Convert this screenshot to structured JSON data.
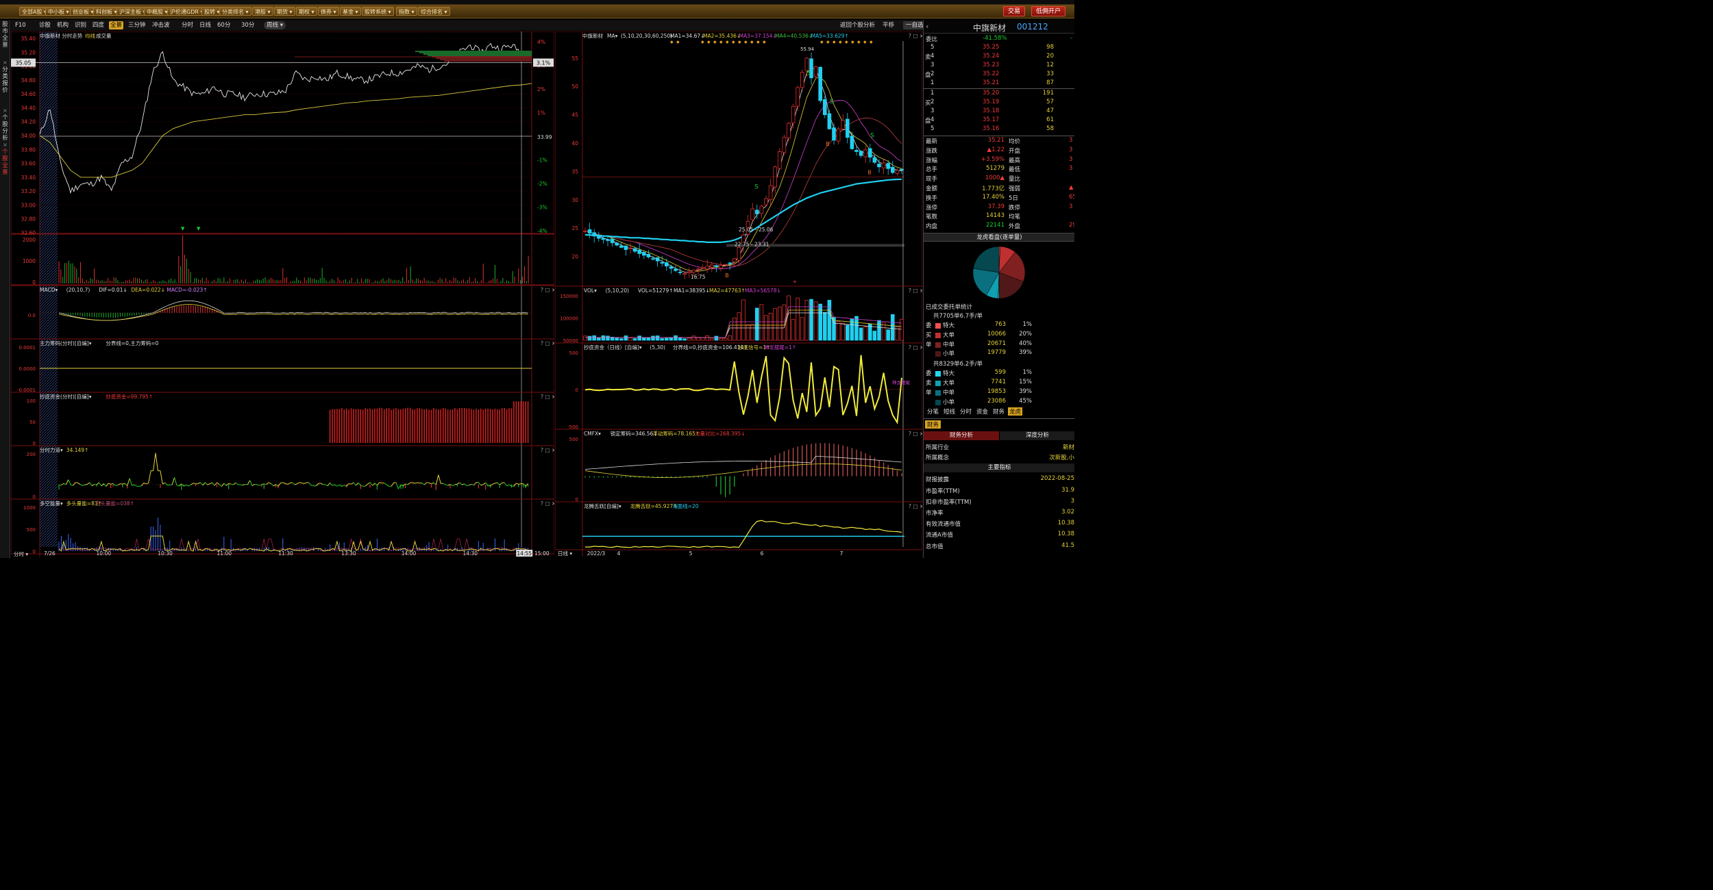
{
  "menu": {
    "items": [
      "全部A股",
      "中小板",
      "创业板",
      "科创板",
      "沪深主板",
      "中概股",
      "沪伦通GDR",
      "股转",
      "分类排名",
      "港股",
      "期货",
      "期权",
      "债券",
      "基金",
      "股转系统",
      "指数",
      "综合排名"
    ],
    "trade": "交易",
    "open_account": "低佣开户"
  },
  "toolbar": {
    "left": [
      "F10",
      "诊股",
      "机构",
      "识别",
      "四度",
      "全景",
      "三分钟",
      "冲击波"
    ],
    "selected": "全景",
    "periods": [
      "分时",
      "日线",
      "60分",
      "30分",
      "周线"
    ],
    "right": [
      "返回个股分析",
      "平移",
      "一自选"
    ]
  },
  "sidebar": [
    "股市全景",
    "分类报价",
    "个股分析",
    "个股全景"
  ],
  "stock": {
    "name": "中旗新材",
    "code": "001212"
  },
  "intraday": {
    "header": "中旗新材  分时走势",
    "avg_label": "均线",
    "vol_label": "成交量",
    "price_ticks": [
      "35.40",
      "35.20",
      "35.00",
      "34.80",
      "34.60",
      "34.40",
      "34.20",
      "34.00",
      "33.80",
      "33.60",
      "33.40",
      "33.20",
      "33.00",
      "32.80",
      "32.60"
    ],
    "pct_ticks": [
      "4%",
      "3%",
      "2%",
      "1%",
      "-1%",
      "-2%",
      "-3%",
      "-4%"
    ],
    "cursor_price": "35.05",
    "cursor_pct": "3.1%",
    "prev_close": "33.99",
    "vol_ticks": [
      "2000",
      "1000",
      "0"
    ],
    "time_ticks": [
      "分时",
      "7/26",
      "10:00",
      "10:30",
      "11:00",
      "11:30",
      "13:30",
      "14:00",
      "14:30",
      "14:55",
      "15:00"
    ],
    "sub_panels": [
      {
        "title": "MACD",
        "params": "(20,10,7)",
        "values": [
          {
            "t": "DIF=0.01↓",
            "c": "#e0e0e0"
          },
          {
            "t": "DEA=0.022↓",
            "c": "#e6d23a"
          },
          {
            "t": "MACD=-0.023↑",
            "c": "#d080ff"
          }
        ],
        "ticks": [
          "0.0"
        ]
      },
      {
        "title": "主力筹码(分时)[自编]",
        "params": "",
        "values": [
          {
            "t": "分界线=0,主力筹码=0",
            "c": "#e0e0e0"
          }
        ],
        "ticks": [
          "0.0001",
          "0.0000",
          "-0.0001"
        ]
      },
      {
        "title": "抄底资金(分时)[自编]",
        "params": "",
        "values": [
          {
            "t": "抄底资金=99.795↑",
            "c": "#f23a3a"
          }
        ],
        "ticks": [
          "100",
          "50",
          "0"
        ]
      },
      {
        "title": "分时力道",
        "params": "",
        "values": [
          {
            "t": "34.149↑",
            "c": "#e6d23a"
          }
        ],
        "ticks": [
          "200",
          "0"
        ]
      },
      {
        "title": "多空能量",
        "params": "",
        "values": [
          {
            "t": "多头量能=83↑",
            "c": "#e6d23a"
          },
          {
            "t": "空头量能=038↑",
            "c": "#c05070"
          }
        ],
        "ticks": [
          "1000",
          "500",
          "0"
        ]
      }
    ]
  },
  "daily": {
    "header": "中旗新材",
    "ma_params": "(5,10,20,30,60,250)",
    "ma_values": [
      {
        "t": "MA1=34.67↓",
        "c": "#e0e0e0"
      },
      {
        "t": "MA2=35.436↓",
        "c": "#e6d23a"
      },
      {
        "t": "MA3=37.154↓",
        "c": "#d040d0"
      },
      {
        "t": "MA4=40.536↓",
        "c": "#40c040"
      },
      {
        "t": "MA5=33.629↑",
        "c": "#20d0f0"
      }
    ],
    "price_ticks": [
      "55",
      "50",
      "45",
      "40",
      "35",
      "30",
      "25",
      "20"
    ],
    "x_ticks": [
      "日线",
      "2022/3",
      "4",
      "5",
      "6",
      "7"
    ],
    "annotations": [
      "55.94",
      "25.05 - 25.06",
      "22.75 - 23.31",
      "16.75"
    ],
    "signals": [
      "S",
      "S",
      "S",
      "S",
      "B",
      "B",
      "B"
    ],
    "sub_panels": [
      {
        "title": "VOL",
        "params": "(5,10,20)",
        "values": [
          {
            "t": "VOL=51279↑",
            "c": "#e0e0e0"
          },
          {
            "t": "MA1=38395↓",
            "c": "#e0e0e0"
          },
          {
            "t": "MA2=47763↑",
            "c": "#e6d23a"
          },
          {
            "t": "MA3=56578↓",
            "c": "#d040d0"
          }
        ],
        "ticks": [
          "150000",
          "100000",
          "50000"
        ]
      },
      {
        "title": "抄底资金（日线）[自编]",
        "params": "(5,30)",
        "values": [
          {
            "t": "分界线=0,抄底资金=106.414↑",
            "c": "#e0e0e0"
          },
          {
            "t": "抄底信号=1↑",
            "c": "#e6d23a"
          },
          {
            "t": "神龙摆尾=1↑",
            "c": "#d040d0"
          }
        ],
        "ticks": [
          "500",
          "0",
          "-500"
        ],
        "tag": "神龙摆尾"
      },
      {
        "title": "CMFX",
        "params": "",
        "values": [
          {
            "t": "锁定筹码=346.56↓",
            "c": "#e0e0e0"
          },
          {
            "t": "浮动筹码=78.165↑",
            "c": "#e6d23a"
          },
          {
            "t": "力量对比=268.395↓",
            "c": "#f23a3a"
          }
        ],
        "ticks": [
          "500",
          "0"
        ]
      },
      {
        "title": "龙腾舌跃[自编]",
        "params": "",
        "values": [
          {
            "t": "龙腾舌跃=45.927↑",
            "c": "#e6d23a"
          },
          {
            "t": "海面线=20",
            "c": "#20d0f0"
          }
        ],
        "ticks": []
      }
    ]
  },
  "quote": {
    "webi_label": "委比",
    "webi_val": "-41.58%",
    "webi_r": "-",
    "sell_label": "卖",
    "buy_label": "买",
    "pan": "盘",
    "sell": [
      {
        "lv": "5",
        "p": "35.25",
        "v": "98"
      },
      {
        "lv": "4",
        "p": "35.24",
        "v": "20"
      },
      {
        "lv": "3",
        "p": "35.23",
        "v": "12"
      },
      {
        "lv": "2",
        "p": "35.22",
        "v": "33"
      },
      {
        "lv": "1",
        "p": "35.21",
        "v": "87"
      }
    ],
    "buy": [
      {
        "lv": "1",
        "p": "35.20",
        "v": "191"
      },
      {
        "lv": "2",
        "p": "35.19",
        "v": "57"
      },
      {
        "lv": "3",
        "p": "35.18",
        "v": "47"
      },
      {
        "lv": "4",
        "p": "35.17",
        "v": "61"
      },
      {
        "lv": "5",
        "p": "35.16",
        "v": "58"
      }
    ],
    "stats": [
      {
        "l": "最新",
        "v": "35.21",
        "c": "red",
        "l2": "均价",
        "v2": "3"
      },
      {
        "l": "涨跌",
        "v": "▲1.22",
        "c": "red",
        "l2": "开盘",
        "v2": "3"
      },
      {
        "l": "涨幅",
        "v": "+3.59%",
        "c": "red",
        "l2": "最高",
        "v2": "3"
      },
      {
        "l": "总手",
        "v": "51279",
        "c": "yel",
        "l2": "最低",
        "v2": "3"
      },
      {
        "l": "现手",
        "v": "1000▲",
        "c": "red",
        "l2": "量比",
        "v2": ""
      },
      {
        "l": "金额",
        "v": "1.773亿",
        "c": "yel",
        "l2": "强弱",
        "v2": "▲"
      },
      {
        "l": "换手",
        "v": "17.40%",
        "c": "yel",
        "l2": "5日",
        "v2": "65."
      },
      {
        "l": "涨停",
        "v": "37.39",
        "c": "red",
        "l2": "跌停",
        "v2": "3"
      },
      {
        "l": "笔数",
        "v": "14143",
        "c": "yel",
        "l2": "均笔",
        "v2": ""
      },
      {
        "l": "内盘",
        "v": "22141",
        "c": "grn",
        "l2": "外盘",
        "v2": "29"
      }
    ],
    "dragon_title": "龙虎看盘(逐单量)",
    "deal_title": "已成交委托单统计",
    "buy_total": "共7705单6.7手/单",
    "buy_rows": [
      {
        "side": "委",
        "n": "特大",
        "v": "763",
        "p": "1%",
        "c": "#f55050"
      },
      {
        "side": "买",
        "n": "大单",
        "v": "10066",
        "p": "20%",
        "c": "#c03030"
      },
      {
        "side": "单",
        "n": "中单",
        "v": "20671",
        "p": "40%",
        "c": "#802020"
      },
      {
        "side": "",
        "n": "小单",
        "v": "19779",
        "p": "39%",
        "c": "#501818"
      }
    ],
    "sell_total": "共8329单6.2手/单",
    "sell_rows": [
      {
        "side": "委",
        "n": "特大",
        "v": "599",
        "p": "1%",
        "c": "#20d8f0"
      },
      {
        "side": "卖",
        "n": "大单",
        "v": "7741",
        "p": "15%",
        "c": "#10a0b0"
      },
      {
        "side": "单",
        "n": "中单",
        "v": "19853",
        "p": "39%",
        "c": "#0a7080"
      },
      {
        "side": "",
        "n": "小单",
        "v": "23086",
        "p": "45%",
        "c": "#064850"
      }
    ],
    "tabs": [
      "分笔",
      "短线",
      "分时",
      "资金",
      "财务",
      "龙虎"
    ],
    "tab_sel": "龙虎",
    "fin_tab": "财务",
    "fin_sub": [
      "财务分析",
      "深度分析"
    ],
    "fin_rows": [
      {
        "l": "所属行业",
        "v": "新材"
      },
      {
        "l": "所属概念",
        "v": "次新股,小"
      }
    ],
    "main_title": "主要指标",
    "main_rows": [
      {
        "l": "财报披露",
        "v": "2022-08-25"
      },
      {
        "l": "市盈率(TTM)",
        "v": "31.9"
      },
      {
        "l": "扣非市盈率(TTM)",
        "v": "3"
      },
      {
        "l": "市净率",
        "v": "3.02"
      },
      {
        "l": "有效流通市值",
        "v": "10.38"
      },
      {
        "l": "流通A市值",
        "v": "10.38"
      },
      {
        "l": "总市值",
        "v": "41.5"
      }
    ]
  },
  "chart_data": [
    {
      "type": "line",
      "title": "中旗新材 分时走势",
      "ylim": [
        32.6,
        35.4
      ],
      "prev_close": 33.99,
      "x": [
        "9:30",
        "9:35",
        "9:40",
        "9:45",
        "9:50",
        "9:55",
        "10:00",
        "10:05",
        "10:10",
        "10:15",
        "10:20",
        "10:25",
        "10:30",
        "10:35",
        "10:40",
        "10:45",
        "10:50",
        "10:55",
        "11:00",
        "11:05",
        "11:10",
        "11:15",
        "11:20",
        "11:25",
        "11:30",
        "13:05",
        "13:10",
        "13:15",
        "13:20",
        "13:25",
        "13:30",
        "13:35",
        "13:40",
        "13:45",
        "13:50",
        "13:55",
        "14:00",
        "14:05",
        "14:10",
        "14:15",
        "14:20",
        "14:25",
        "14:30",
        "14:35",
        "14:40",
        "14:45",
        "14:50",
        "14:55",
        "15:00"
      ],
      "series": [
        {
          "name": "price",
          "values": [
            34.0,
            34.4,
            33.6,
            33.2,
            33.3,
            33.3,
            33.4,
            33.2,
            33.6,
            33.7,
            34.2,
            34.9,
            35.2,
            34.8,
            34.7,
            34.6,
            34.6,
            34.7,
            34.6,
            34.6,
            34.55,
            34.6,
            34.6,
            34.6,
            34.65,
            34.9,
            34.8,
            34.85,
            34.8,
            34.9,
            34.85,
            34.8,
            34.8,
            34.85,
            34.9,
            34.9,
            34.95,
            35.0,
            34.95,
            35.0,
            35.05,
            35.2,
            35.3,
            35.2,
            35.3,
            35.25,
            35.3,
            35.2,
            35.21
          ]
        },
        {
          "name": "avg",
          "values": [
            34.0,
            33.9,
            33.7,
            33.5,
            33.4,
            33.4,
            33.4,
            33.4,
            33.45,
            33.5,
            33.6,
            33.8,
            34.0,
            34.1,
            34.15,
            34.2,
            34.22,
            34.24,
            34.26,
            34.28,
            34.3,
            34.3,
            34.32,
            34.33,
            34.34,
            34.37,
            34.39,
            34.41,
            34.43,
            34.45,
            34.47,
            34.48,
            34.5,
            34.51,
            34.52,
            34.53,
            34.55,
            34.56,
            34.57,
            34.58,
            34.6,
            34.62,
            34.64,
            34.66,
            34.68,
            34.7,
            34.72,
            34.73,
            34.75
          ]
        }
      ]
    },
    {
      "type": "candlestick",
      "title": "中旗新材 日线",
      "ylim": [
        15,
        58
      ],
      "x": [
        "2022/3",
        "4",
        "5",
        "6",
        "7"
      ],
      "series": [
        {
          "name": "close",
          "values": [
            24.5,
            24.1,
            23.6,
            23.2,
            23.0,
            22.8,
            22.4,
            22.0,
            21.6,
            21.2,
            21.5,
            20.9,
            20.5,
            20.2,
            19.9,
            19.5,
            19.2,
            18.8,
            18.3,
            17.9,
            17.5,
            17.2,
            17.0,
            17.3,
            17.6,
            17.8,
            18.1,
            18.3,
            18.5,
            18.2,
            18.4,
            18.6,
            18.8,
            19.6,
            21.6,
            23.8,
            26.2,
            28.4,
            27.5,
            28.9,
            30.2,
            32.5,
            35.8,
            38.5,
            41.0,
            43.5,
            46.5,
            49.8,
            52.5,
            55.0,
            51.5,
            53.5,
            47.5,
            45.0,
            42.5,
            40.5,
            42.5,
            44.0,
            41.0,
            39.0,
            38.5,
            37.8,
            38.8,
            37.5,
            36.6,
            35.8,
            36.5,
            35.5,
            34.8,
            35.2,
            35.2
          ]
        },
        {
          "name": "MA5",
          "values": [
            23.8,
            23.8,
            23.7,
            23.7,
            23.6,
            23.6,
            23.5,
            23.5,
            23.4,
            23.4,
            23.3,
            23.3,
            23.3,
            23.2,
            23.2,
            23.1,
            23.1,
            23.0,
            23.0,
            22.9,
            22.9,
            22.8,
            22.8,
            22.7,
            22.7,
            22.6,
            22.6,
            22.5,
            22.5,
            22.5,
            22.5,
            22.6,
            22.7,
            22.9,
            23.2,
            23.6,
            24.1,
            24.6,
            25.1,
            25.6,
            26.1,
            26.6,
            27.1,
            27.6,
            28.1,
            28.6,
            29.1,
            29.5,
            29.9,
            30.3,
            30.6,
            30.9,
            31.2,
            31.4,
            31.6,
            31.8,
            32.0,
            32.2,
            32.4,
            32.6,
            32.8,
            32.9,
            33.0,
            33.1,
            33.2,
            33.3,
            33.4,
            33.5,
            33.55,
            33.6,
            33.63
          ]
        }
      ]
    }
  ]
}
